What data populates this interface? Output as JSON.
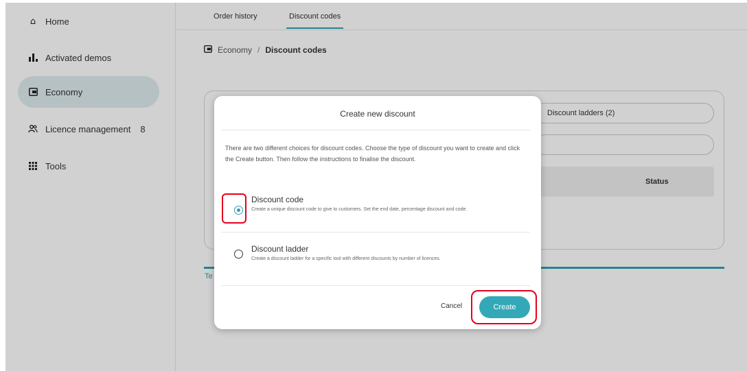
{
  "sidebar": {
    "items": [
      {
        "label": "Home",
        "icon": "home-icon"
      },
      {
        "label": "Activated demos",
        "icon": "bar-chart-icon"
      },
      {
        "label": "Economy",
        "icon": "wallet-icon"
      },
      {
        "label": "Licence management",
        "icon": "users-icon",
        "badge": "8"
      },
      {
        "label": "Tools",
        "icon": "grid-icon"
      }
    ]
  },
  "tabs": [
    {
      "label": "Order history"
    },
    {
      "label": "Discount codes"
    }
  ],
  "breadcrumb": {
    "parent": "Economy",
    "separator": "/",
    "current": "Discount codes"
  },
  "background": {
    "ladders_pill": "Discount ladders (2)",
    "table_col_partial": "e",
    "table_col_status": "Status",
    "bottom_text": "Te"
  },
  "modal": {
    "title": "Create new discount",
    "description": "There are two different choices for discount codes. Choose the type of discount you want to create and click the Create button. Then follow the instructions to finalise the discount.",
    "options": [
      {
        "title": "Discount code",
        "description": "Create a unique discount code to give to customers. Set the end date, percentage discount and code.",
        "selected": true
      },
      {
        "title": "Discount ladder",
        "description": "Create a discount ladder for a specific tool with different discounts by number of licences.",
        "selected": false
      }
    ],
    "cancel_label": "Cancel",
    "create_label": "Create"
  },
  "colors": {
    "accent": "#33a9b8",
    "highlight": "#e3001b",
    "active_nav": "#dfecef"
  }
}
